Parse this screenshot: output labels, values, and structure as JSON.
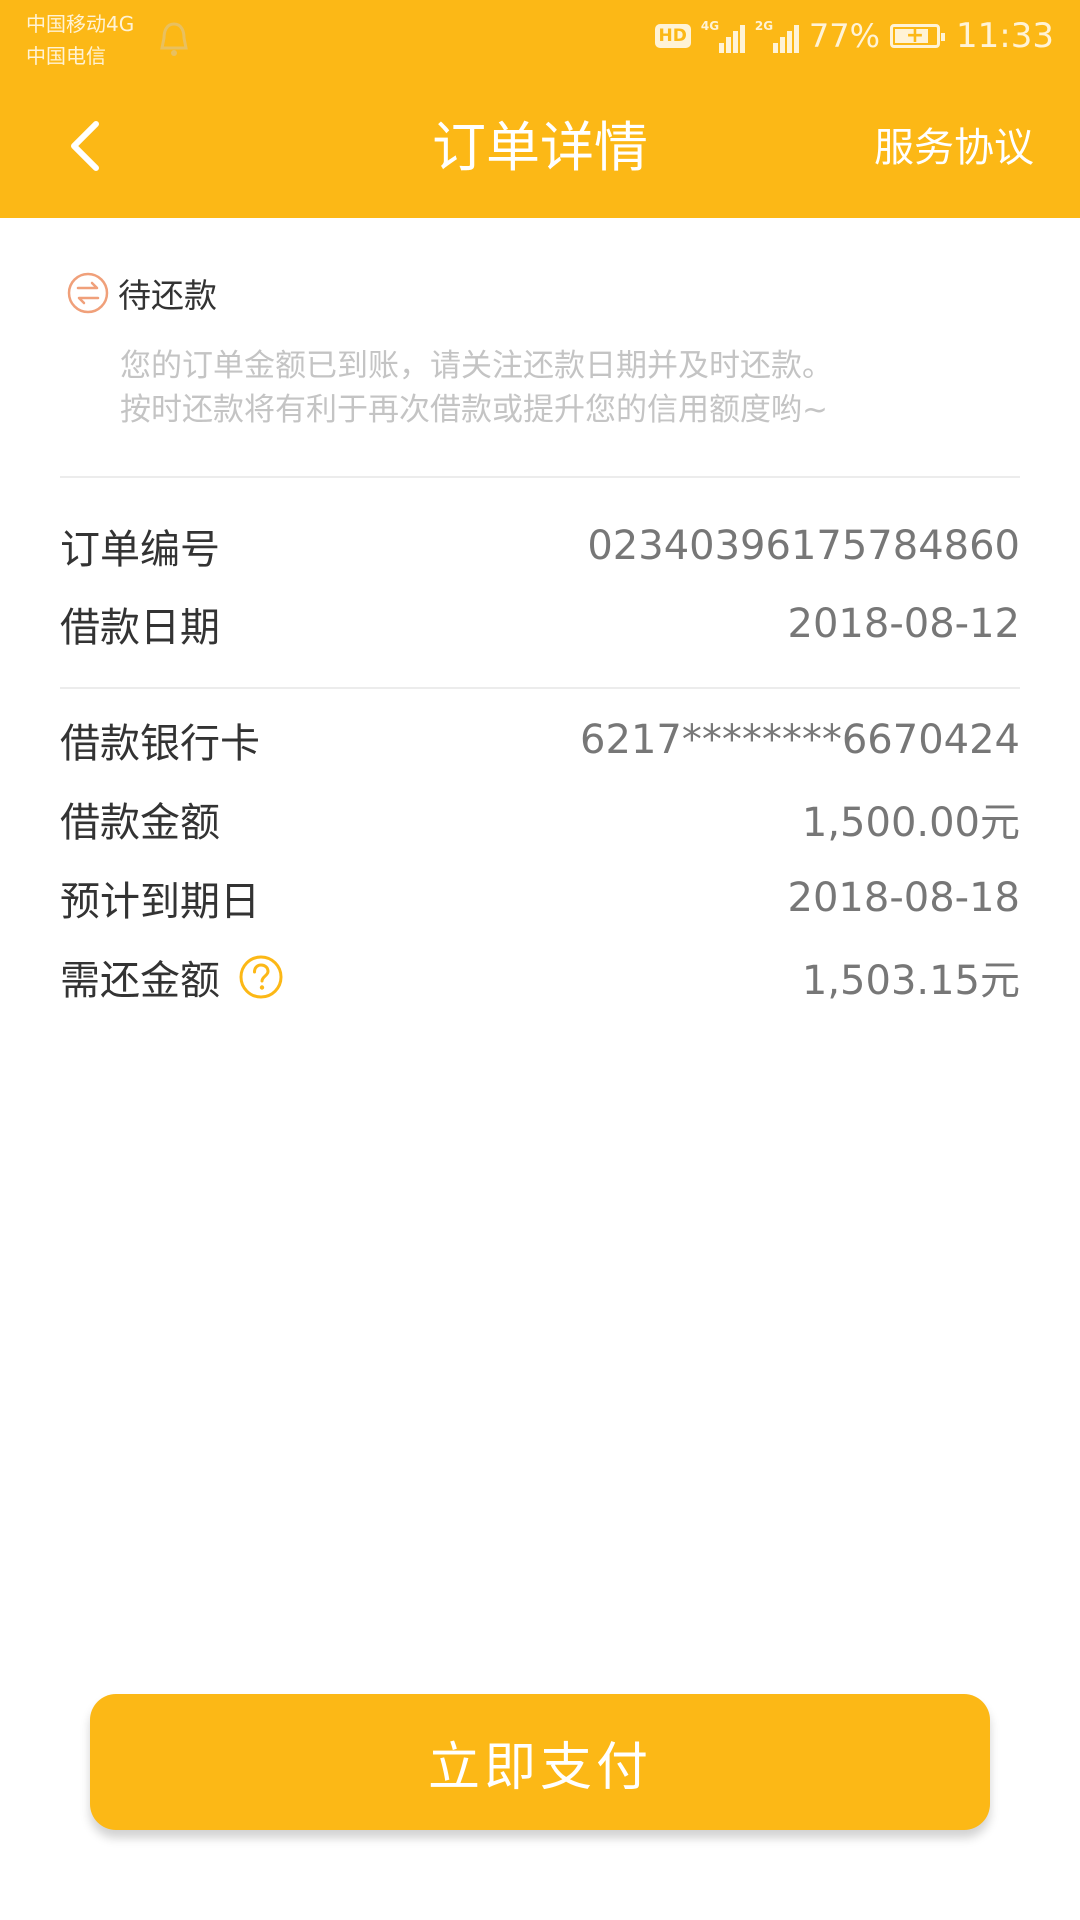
{
  "status_bar": {
    "carrier1": "中国移动4G",
    "carrier2": "中国电信",
    "hd": "HD",
    "net1": "4G",
    "net2": "2G",
    "battery": "77%",
    "time": "11:33"
  },
  "header": {
    "title": "订单详情",
    "right_link": "服务协议",
    "background_color": "#FCB816"
  },
  "order_status": {
    "label": "待还款",
    "icon": "swap-arrows-icon",
    "notice_line1": "您的订单金额已到账，请关注还款日期并及时还款。",
    "notice_line2": "按时还款将有利于再次借款或提升您的信用额度哟~"
  },
  "section1": [
    {
      "label": "订单编号",
      "value": "02340396175784860"
    },
    {
      "label": "借款日期",
      "value": "2018-08-12"
    }
  ],
  "section2": [
    {
      "label": "借款银行卡",
      "value": "6217********6670424"
    },
    {
      "label": "借款金额",
      "value": "1,500.00元"
    },
    {
      "label": "预计到期日",
      "value": "2018-08-18"
    },
    {
      "label": "需还金额",
      "value": "1,503.15元",
      "icon": "question-icon"
    }
  ],
  "pay_button": {
    "label": "立即支付"
  },
  "colors": {
    "accent": "#FCB816",
    "notice_text": "#c4c4c4"
  }
}
